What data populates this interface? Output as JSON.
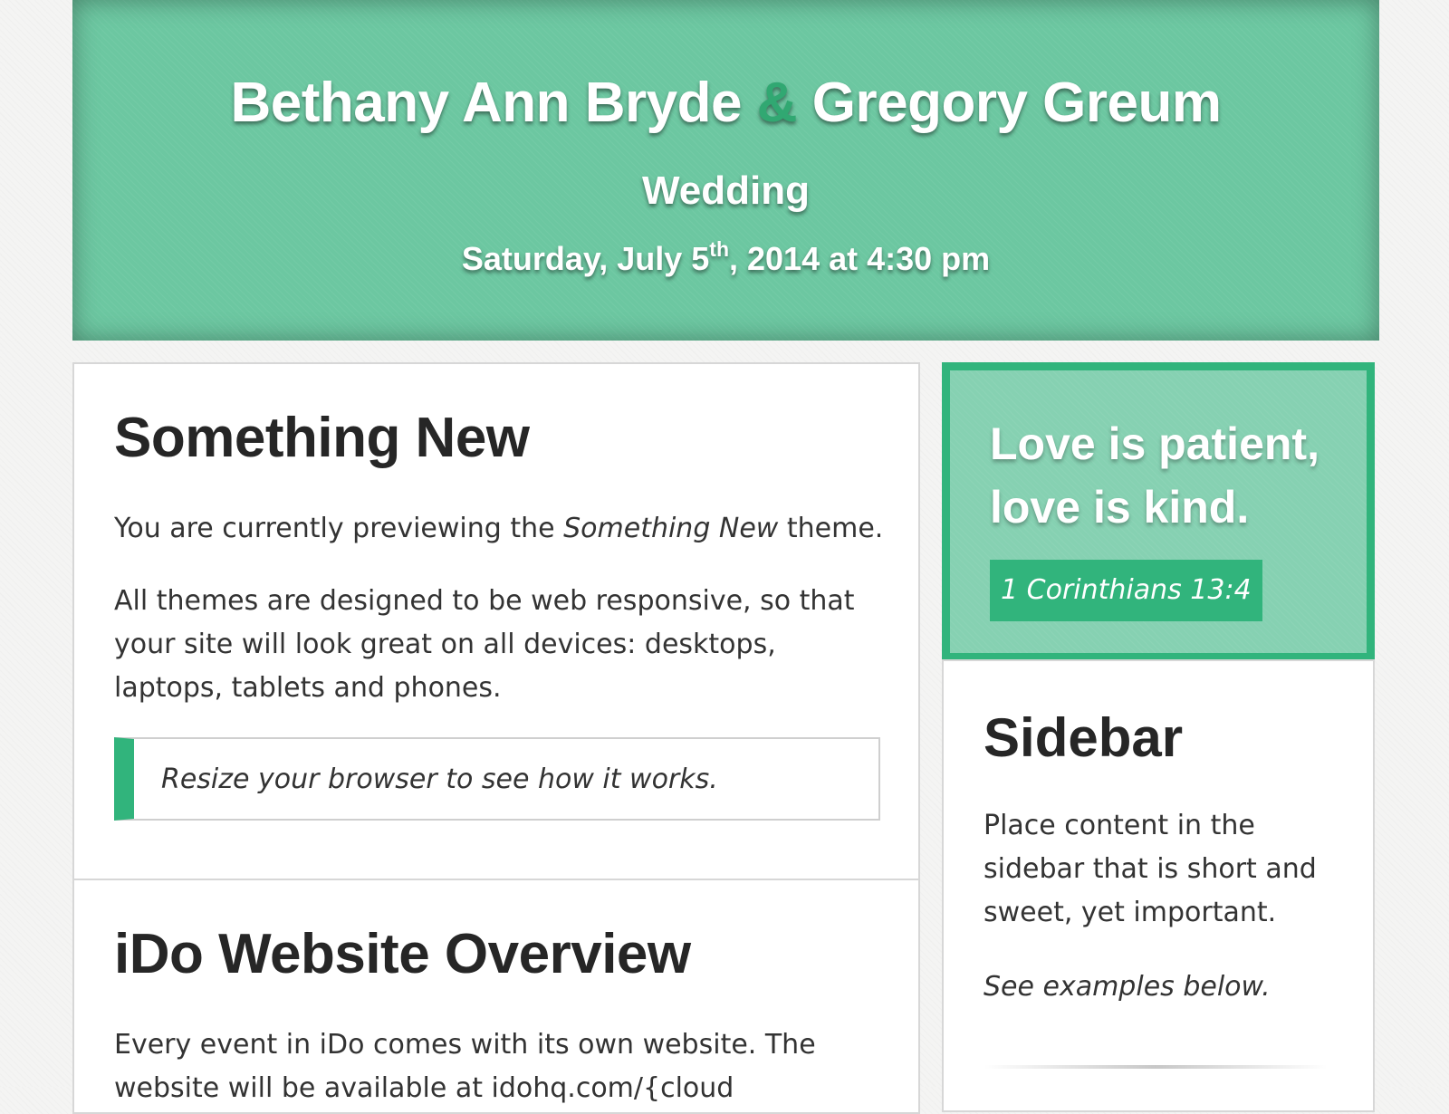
{
  "hero": {
    "name_one": "Bethany Ann Bryde",
    "ampersand": "&",
    "name_two": "Gregory Greum",
    "event": "Wedding",
    "date_prefix": "Saturday, July 5",
    "date_suffix": "th",
    "date_rest": ", 2014 at 4:30 pm"
  },
  "intro_card": {
    "title": "Something New",
    "p1_before": "You are currently previewing the",
    "p1_em": "Something New",
    "p1_after": "theme.",
    "p2": "All themes are designed to be web responsive, so that your site will look great on all devices: desktops, laptops, tablets and phones.",
    "callout": "Resize your browser to see how it works."
  },
  "overview_card": {
    "title": "iDo Website Overview",
    "text": "Every event in iDo comes with its own website. The website will be available at idohq.com/{cloud"
  },
  "quote": {
    "text": "Love is patient, love is kind.",
    "reference": "1 Corinthians 13:4"
  },
  "sidebar": {
    "title": "Sidebar",
    "text": "Place content in the sidebar that is short and sweet, yet important.",
    "note": "See examples below."
  },
  "colors": {
    "accent": "#31b47c",
    "hero_bg": "#6cc7a1"
  }
}
